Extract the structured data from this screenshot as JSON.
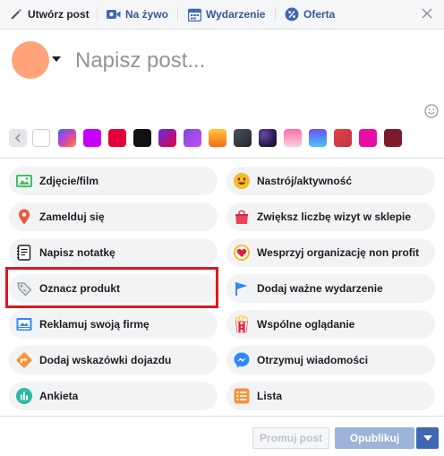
{
  "tabs": [
    {
      "label": "Utwórz post",
      "icon": "pencil-icon"
    },
    {
      "label": "Na żywo",
      "icon": "video-camera-icon"
    },
    {
      "label": "Wydarzenie",
      "icon": "calendar-icon"
    },
    {
      "label": "Oferta",
      "icon": "discount-tag-icon"
    }
  ],
  "close_icon": "close-icon",
  "composer": {
    "placeholder": "Napisz post...",
    "avatar_color": "#ffa47a"
  },
  "swatches": [
    {
      "name": "previous",
      "color": "#e4e6eb"
    },
    {
      "name": "white",
      "color": "#ffffff"
    },
    {
      "name": "abstract",
      "color": "#c244c8"
    },
    {
      "name": "purple",
      "color": "#c600ff"
    },
    {
      "name": "red",
      "color": "#e2013b"
    },
    {
      "name": "black",
      "color": "#111111"
    },
    {
      "name": "purple-red",
      "color": "#8e2ec4"
    },
    {
      "name": "violet",
      "color": "#a04df4"
    },
    {
      "name": "orange",
      "color": "#f99a22"
    },
    {
      "name": "dark-gray",
      "color": "#3a4149"
    },
    {
      "name": "galaxy",
      "color": "#2a1b4d"
    },
    {
      "name": "pink",
      "color": "#f06292"
    },
    {
      "name": "blue",
      "color": "#4f87f5"
    },
    {
      "name": "crimson",
      "color": "#d53a3e"
    },
    {
      "name": "magenta",
      "color": "#e90ea6"
    },
    {
      "name": "maroon",
      "color": "#7e1a2c"
    }
  ],
  "actions_left": [
    {
      "label": "Zdjęcie/film",
      "icon": "photo-video-icon"
    },
    {
      "label": "Zamelduj się",
      "icon": "location-pin-icon"
    },
    {
      "label": "Napisz notatkę",
      "icon": "note-icon"
    },
    {
      "label": "Oznacz produkt",
      "icon": "product-tag-icon"
    },
    {
      "label": "Reklamuj swoją firmę",
      "icon": "advertise-icon"
    },
    {
      "label": "Dodaj wskazówki dojazdu",
      "icon": "directions-icon"
    },
    {
      "label": "Ankieta",
      "icon": "poll-icon"
    }
  ],
  "actions_right": [
    {
      "label": "Nastrój/aktywność",
      "icon": "smiley-icon"
    },
    {
      "label": "Zwiększ liczbę wizyt w sklepie",
      "icon": "shopping-bag-icon"
    },
    {
      "label": "Wesprzyj organizację non profit",
      "icon": "heart-donate-icon"
    },
    {
      "label": "Dodaj ważne wydarzenie",
      "icon": "flag-icon"
    },
    {
      "label": "Wspólne oglądanie",
      "icon": "popcorn-icon"
    },
    {
      "label": "Otrzymuj wiadomości",
      "icon": "messenger-icon"
    },
    {
      "label": "Lista",
      "icon": "list-icon"
    }
  ],
  "footer": {
    "promote_label": "Promuj post",
    "publish_label": "Opublikuj"
  },
  "colors": {
    "highlight": "#e0161e",
    "brand_blue": "#4267b2"
  }
}
